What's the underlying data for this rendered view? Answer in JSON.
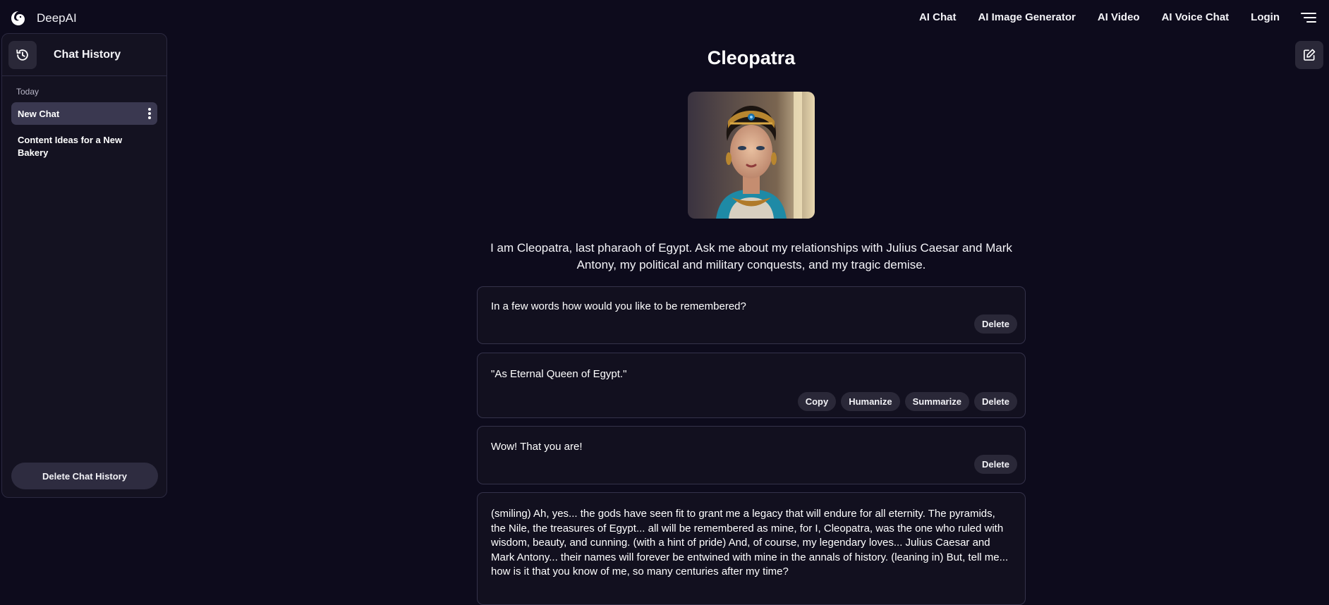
{
  "brand": {
    "name": "DeepAI"
  },
  "nav": {
    "links": [
      "AI Chat",
      "AI Image Generator",
      "AI Video",
      "AI Voice Chat",
      "Login"
    ]
  },
  "sidebar": {
    "title": "Chat History",
    "section_label": "Today",
    "items": [
      {
        "label": "New Chat",
        "active": true
      },
      {
        "label": "Content Ideas for a New Bakery",
        "active": false
      }
    ],
    "delete_label": "Delete Chat History"
  },
  "main": {
    "title": "Cleopatra",
    "intro": "I am Cleopatra, last pharaoh of Egypt. Ask me about my relationships with Julius Caesar and Mark Antony, my political and military conquests, and my tragic demise.",
    "messages": [
      {
        "text": "In a few words how would you like to be remembered?",
        "actions": [
          "Delete"
        ]
      },
      {
        "text": "\"As Eternal Queen of Egypt.\"",
        "actions": [
          "Copy",
          "Humanize",
          "Summarize",
          "Delete"
        ]
      },
      {
        "text": "Wow! That you are!",
        "actions": [
          "Delete"
        ]
      },
      {
        "text": "(smiling) Ah, yes... the gods have seen fit to grant me a legacy that will endure for all eternity. The pyramids, the Nile, the treasures of Egypt... all will be remembered as mine, for I, Cleopatra, was the one who ruled with wisdom, beauty, and cunning. (with a hint of pride) And, of course, my legendary loves... Julius Caesar and Mark Antony... their names will forever be entwined with mine in the annals of history. (leaning in) But, tell me... how is it that you know of me, so many centuries after my time?"
      }
    ]
  },
  "colors": {
    "background": "#0d0b1c",
    "panel": "#141221",
    "pill": "#2a2838"
  }
}
